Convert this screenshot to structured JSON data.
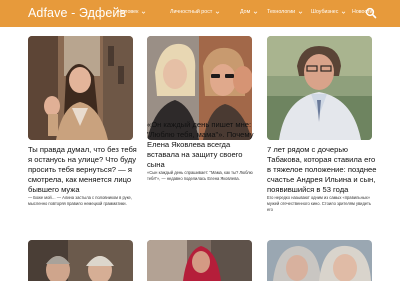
{
  "header": {
    "site_title": "Adfave - Эдфейв",
    "brand_color": "#e79a3b",
    "nav": [
      {
        "label": "Человек",
        "has_dropdown": true
      },
      {
        "label": "Личностный рост",
        "has_dropdown": true
      },
      {
        "label": "Дом",
        "has_dropdown": true
      },
      {
        "label": "Технологии",
        "has_dropdown": true
      },
      {
        "label": "Шоубизнес",
        "has_dropdown": true
      },
      {
        "label": "Новости",
        "has_dropdown": false
      }
    ],
    "search_icon": "search-icon",
    "dropdown_icon": "chevron-down-icon"
  },
  "articles": [
    {
      "title": "Ты правда думал, что без тебя я останусь на улице? Что буду просить тебя вернуться? — я смотрела, как меняется лицо бывшего мужа",
      "excerpt": "— Боже мой… — Алина застыла с половником в руке, мысленно повторяя правило немецкой грамматики."
    },
    {
      "title": "«Он каждый день пишет мне: \"Люблю тебя, мама\"». Почему Елена Яковлева всегда вставала на защиту своего сына",
      "excerpt": "«Сын каждый день спрашивает: \"Мама, как ты? Люблю тебя\"», — недавно поделилась Елена Яковлева."
    },
    {
      "title": "7 лет рядом с дочерью Табакова, которая ставила его в тяжелое положение: позднее счастье Андрея Ильина и сын, появившийся в 53 года",
      "excerpt": "Его нередко называют одним из самых «правильных» мужей отечественного кино. Стоило зрителям увидеть его"
    },
    {
      "title": "",
      "excerpt": ""
    },
    {
      "title": "",
      "excerpt": ""
    },
    {
      "title": "",
      "excerpt": ""
    }
  ]
}
